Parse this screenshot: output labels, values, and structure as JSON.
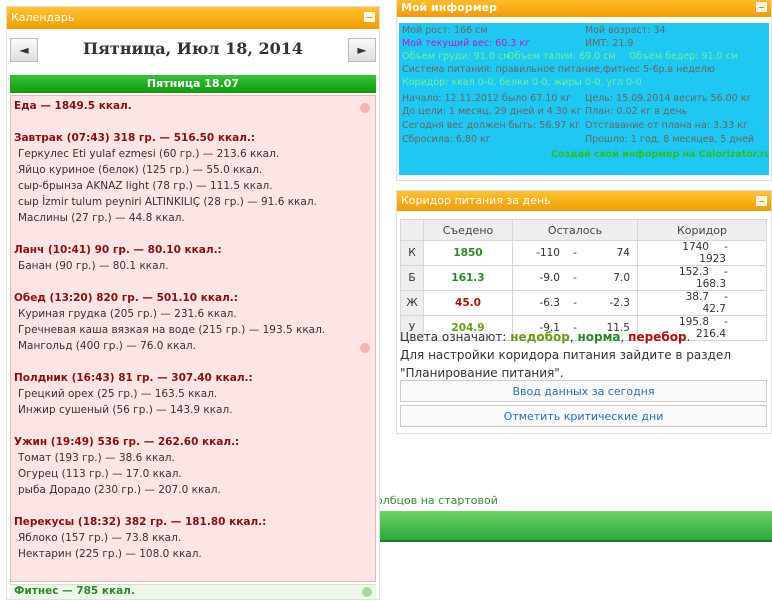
{
  "background_link": "олбцов на стартовой",
  "calendar": {
    "header": "Календарь",
    "prev": "◄",
    "next": "►",
    "title": "Пятница, Июл 18, 2014",
    "day_bar": "Пятница 18.07",
    "lines": [
      {
        "text": "Еда — 1849.5 ккал.",
        "meal": true
      },
      {
        "text": "Завтрак (07:43) 318 гр. — 516.50 ккал.:",
        "meal": true
      },
      {
        "text": "Геркулес Eti yulaf ezmesi (60 гр.) — 213.6 ккал."
      },
      {
        "text": "Яйцо куриное (белок) (125 гр.) — 55.0 ккал."
      },
      {
        "text": "сыр-брынза AKNAZ light (78 гр.) — 111.5 ккал."
      },
      {
        "text": "сыр İzmir tulum peyniri ALTINKILIÇ (28 гр.) — 91.6 ккал."
      },
      {
        "text": "Маслины (27 гр.) — 44.8 ккал."
      },
      {
        "text": "Ланч (10:41) 90 гр. — 80.10 ккал.:",
        "meal": true
      },
      {
        "text": "Банан (90 гр.) — 80.1 ккал."
      },
      {
        "text": "Обед (13:20) 820 гр. — 501.10 ккал.:",
        "meal": true
      },
      {
        "text": "Куриная грудка (205 гр.) — 231.6 ккал."
      },
      {
        "text": "Гречневая каша вязкая на воде (215 гр.) — 193.5 ккал."
      },
      {
        "text": "Мангольд (400 гр.) — 76.0 ккал."
      },
      {
        "text": "Полдник (16:43) 81 гр. — 307.40 ккал.:",
        "meal": true
      },
      {
        "text": "Грецкий орех (25 гр.) — 163.5 ккал."
      },
      {
        "text": "Инжир сушеный (56 гр.) — 143.9 ккал."
      },
      {
        "text": "Ужин (19:49) 536 гр. — 262.60 ккал.:",
        "meal": true
      },
      {
        "text": "Томат (193 гр.) — 38.6 ккал."
      },
      {
        "text": "Огурец (113 гр.) — 17.0 ккал."
      },
      {
        "text": "рыба Дорадо (230 гр.) — 207.0 ккал."
      },
      {
        "text": "Перекусы (18:32) 382 гр. — 181.80 ккал.:",
        "meal": true
      },
      {
        "text": "Яблоко (157 гр.) — 73.8 ккал."
      },
      {
        "text": "Нектарин (225 гр.) — 108.0 ккал."
      }
    ],
    "fitness": "Фитнес — 785 ккал."
  },
  "informer": {
    "header": "Мой информер",
    "lines": [
      {
        "text": "Мой рост: 166 см",
        "style": ""
      },
      {
        "text": "Мой возраст: 34",
        "style": ""
      },
      {
        "text": "Мой текущий вес: 60.3 кг",
        "style": "purple"
      },
      {
        "text": "ИМТ: 21.9",
        "style": ""
      },
      {
        "text": "Объем груди: 91.0 см",
        "style": "green"
      },
      {
        "text": "Объем талии: 69.0 см",
        "style": "green"
      },
      {
        "text": "Объем бедер: 91.0 см",
        "style": "green"
      },
      {
        "text": "Система питания: правильное питание,фитнес 5-6р.в неделю",
        "style": ""
      },
      {
        "text": "Коридор: ккал 0-0, белки 0-0, жиры 0-0, угл 0-0",
        "style": "green"
      },
      {
        "text": "Начало: 12.11.2012 было 67.10 кг",
        "style": ""
      },
      {
        "text": "Цель: 15.09.2014 весить 56.00 кг",
        "style": ""
      },
      {
        "text": "До цели: 1 месяц, 29 дней и 4.30 кг",
        "style": ""
      },
      {
        "text": "План: 0.02 кг в день",
        "style": ""
      },
      {
        "text": "Сегодня вес должен быть: 56.97 кг",
        "style": ""
      },
      {
        "text": "Отставание от плана на: 3.33 кг",
        "style": ""
      },
      {
        "text": "Сбросила: 6.80 кг",
        "style": ""
      },
      {
        "text": "Прошло: 1 год, 8 месяцев, 5 дней",
        "style": ""
      },
      {
        "text": "Создай свой информер на Calorizator.ru",
        "style": "brand"
      }
    ]
  },
  "corridor": {
    "header": "Коридор питания за день",
    "columns": [
      "Съедено",
      "Осталось",
      "Коридор"
    ],
    "rows": [
      {
        "label": "К",
        "eaten": "1850",
        "eaten_color": "#2a8a2a",
        "left1": "-110",
        "left2": "74",
        "c1": "1740",
        "c2": "1923"
      },
      {
        "label": "Б",
        "eaten": "161.3",
        "eaten_color": "#2a8a2a",
        "left1": "-9.0",
        "left2": "7.0",
        "c1": "152.3",
        "c2": "168.3"
      },
      {
        "label": "Ж",
        "eaten": "45.0",
        "eaten_color": "#b01010",
        "left1": "-6.3",
        "left2": "-2.3",
        "c1": "38.7",
        "c2": "42.7"
      },
      {
        "label": "У",
        "eaten": "204.9",
        "eaten_color": "#6a9a1a",
        "left1": "-9.1",
        "left2": "11.5",
        "c1": "195.8",
        "c2": "216.4"
      }
    ],
    "dash": "-",
    "legend_prefix": "Цвета означают:",
    "legend_under": "недобор",
    "legend_norm": "норма",
    "legend_over": "перебор",
    "legend_note": "Для настройки коридора питания зайдите в раздел \"Планирование питания\".",
    "btn_today": "Ввод данных за сегодня",
    "btn_critical": "Отметить критические дни"
  }
}
